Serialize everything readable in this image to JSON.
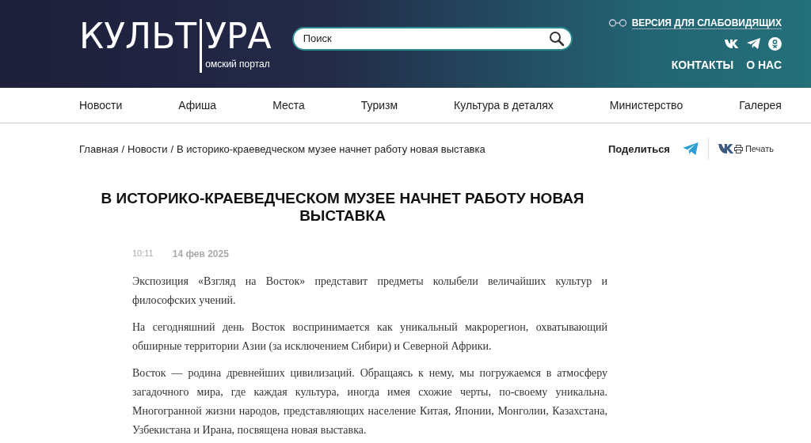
{
  "header": {
    "logo_left": "КУЛЬТ",
    "logo_right": "УРА",
    "logo_subtitle": "омский портал",
    "search": {
      "placeholder": "Поиск"
    },
    "accessibility_link": "ВЕРСИЯ ДЛЯ СЛАБОВИДЯЩИХ",
    "links": [
      "КОНТАКТЫ",
      "О НАС"
    ]
  },
  "nav": {
    "items": [
      {
        "label": "Новости",
        "selected": false
      },
      {
        "label": "Афиша",
        "selected": false
      },
      {
        "label": "Места",
        "selected": false
      },
      {
        "label": "Туризм",
        "selected": false
      },
      {
        "label": "Культура в деталях",
        "selected": false
      },
      {
        "label": "Министерство",
        "selected": false
      },
      {
        "label": "Галерея",
        "selected": false
      }
    ]
  },
  "breadcrumb": {
    "separator": "/",
    "items": [
      "Главная",
      "Новости",
      "В историко-краеведческом музее начнет работу новая выставка"
    ]
  },
  "share": {
    "label": "Поделиться",
    "print": "Печать"
  },
  "article": {
    "title": "В ИСТОРИКО-КРАЕВЕДЧЕСКОМ МУЗЕЕ НАЧНЕТ РАБОТУ НОВАЯ ВЫСТАВКА",
    "time": "10:11",
    "date": "14 фев 2025",
    "paragraphs": [
      "Экспозиция «Взгляд на Восток» представит предметы колыбели величайших культур и философских учений.",
      "На сегодняшний день Восток воспринимается как уникальный макрорегион, охватывающий обширные территории Азии (за исключением Сибири) и Северной Африки.",
      "Восток — родина древнейших цивилизаций. Обращаясь к нему, мы погружаемся в атмосферу загадочного мира, где каждая культура, иногда имея схожие черты, по-своему уникальна. Многогранной жизни народов, представляющих население Китая, Японии, Монголии, Казахстана, Узбекистана и Ирана, посвящена новая выставка."
    ]
  }
}
